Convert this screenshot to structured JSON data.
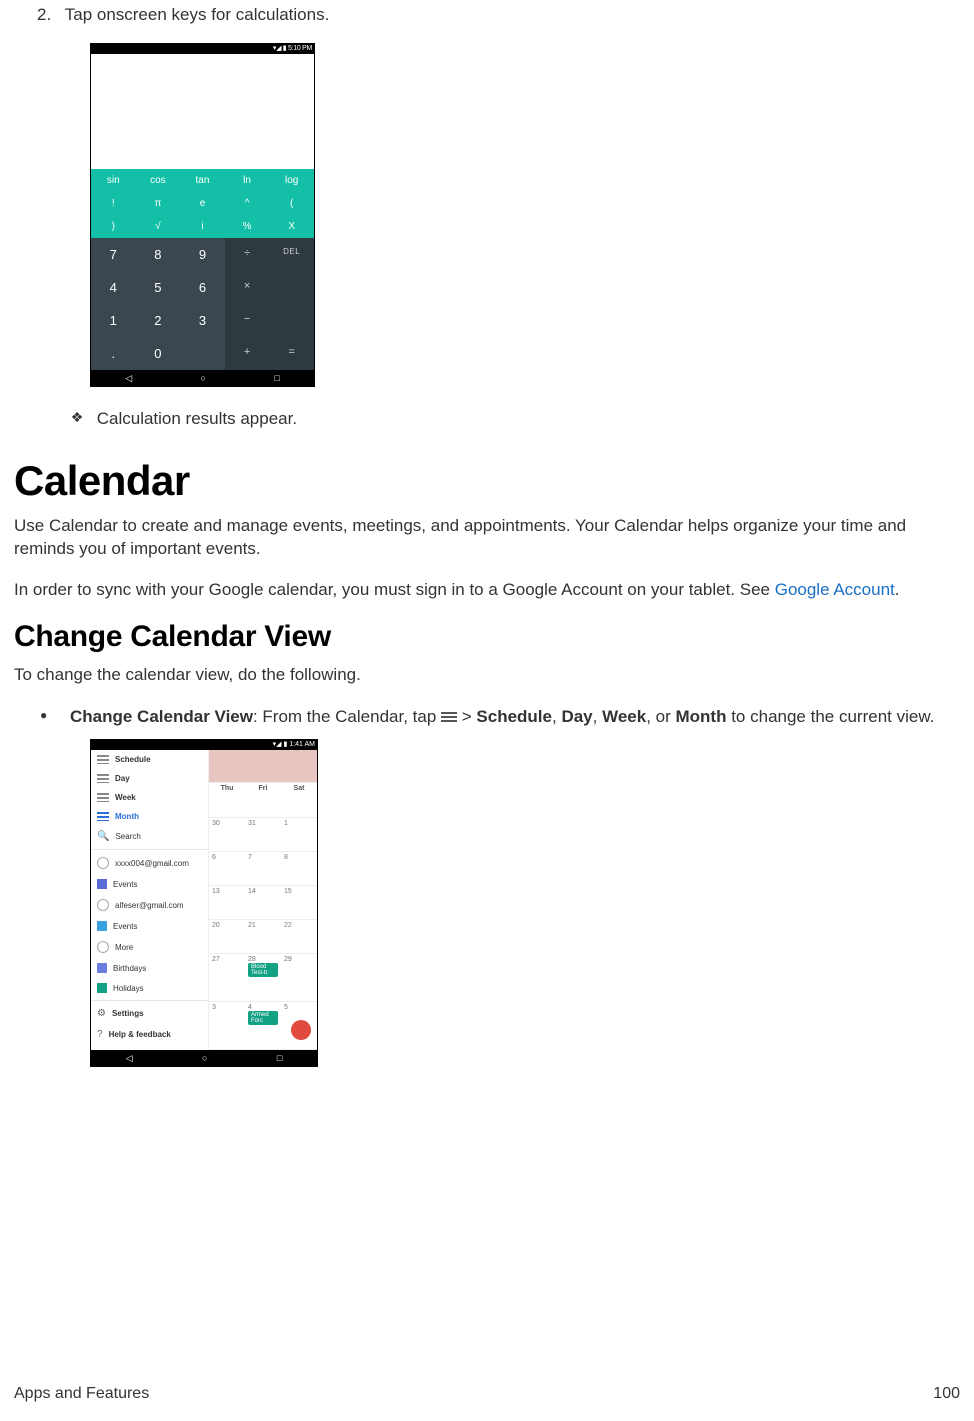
{
  "step": {
    "num": "2.",
    "text": "Tap onscreen keys for calculations."
  },
  "calc": {
    "status_time": "5:10 PM",
    "sci_rows": [
      [
        "sin",
        "cos",
        "tan",
        "ln",
        "log"
      ],
      [
        "!",
        "π",
        "e",
        "^",
        "(",
        ""
      ],
      [
        ")",
        "√",
        "i",
        "%",
        "X",
        ""
      ]
    ],
    "nums": [
      "7",
      "8",
      "9",
      "4",
      "5",
      "6",
      "1",
      "2",
      "3",
      ".",
      "0",
      ""
    ],
    "ops": [
      "÷",
      "DEL",
      "×",
      "",
      "−",
      "",
      "+",
      "="
    ]
  },
  "diamond_text": "Calculation results appear.",
  "h1": "Calendar",
  "p1": "Use Calendar to create and manage events, meetings, and appointments. Your Calendar helps organize your time and reminds you of important events.",
  "p2a": "In order to sync with your Google calendar, you must sign in to a Google Account on your tablet. See ",
  "p2_link": "Google Account",
  "p2b": ".",
  "h2": "Change Calendar View",
  "p3": "To change the calendar view, do the following.",
  "bullet": {
    "b1": "Change Calendar View",
    "t1": ": From the Calendar, tap ",
    "t2": " > ",
    "b2": "Schedule",
    "c1": ", ",
    "b3": "Day",
    "c2": ", ",
    "b4": "Week",
    "c3": ", or ",
    "b5": "Month",
    "t3": " to change the current view."
  },
  "cal": {
    "status_time": "1:41 AM",
    "side": {
      "schedule": "Schedule",
      "day": "Day",
      "week": "Week",
      "month": "Month",
      "search": "Search",
      "acct1": "xxxx004@gmail.com",
      "events1": "Events",
      "acct2": "alfeser@gmail.com",
      "events2": "Events",
      "more": "More",
      "birthdays": "Birthdays",
      "holidays": "Holidays",
      "settings": "Settings",
      "help": "Help & feedback"
    },
    "gridhdr": [
      "Thu",
      "Fri",
      "Sat"
    ],
    "grid": [
      "30",
      "31",
      "1",
      "6",
      "7",
      "8",
      "13",
      "14",
      "15",
      "20",
      "21",
      "22",
      "27",
      "28",
      "29",
      "3",
      "4",
      "5"
    ],
    "chip1": "Blood Test-b",
    "chip2": "Armed Forc"
  },
  "footer": {
    "left": "Apps and Features",
    "right": "100"
  }
}
